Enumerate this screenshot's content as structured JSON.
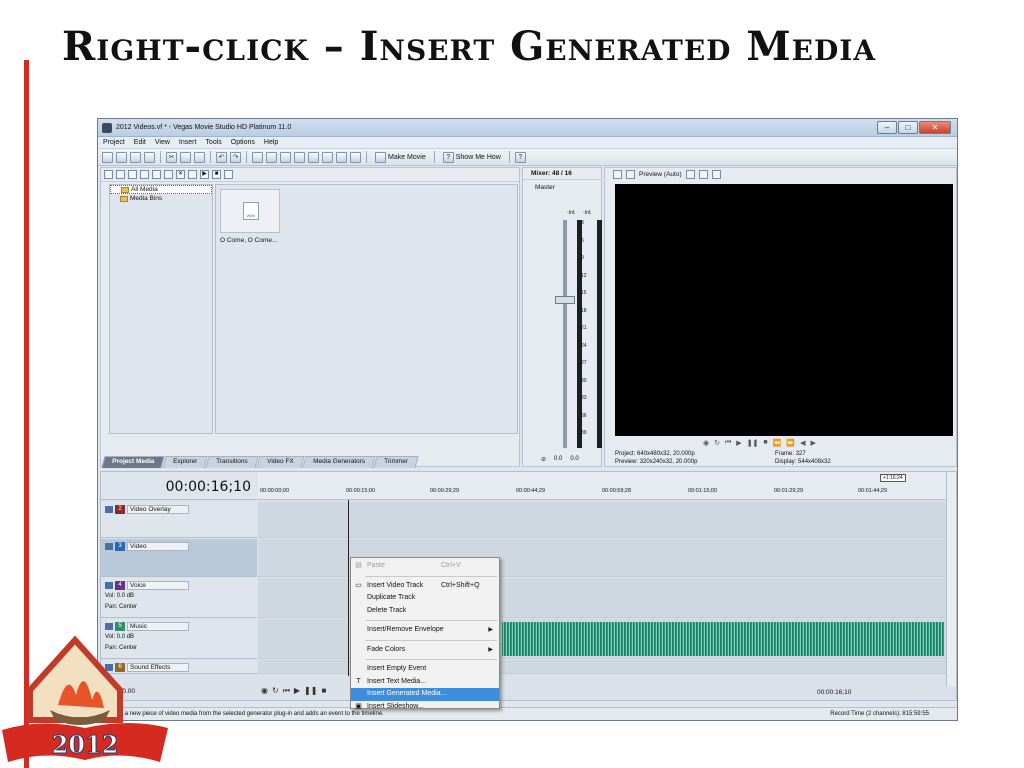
{
  "slide": {
    "title": "Right-click – Insert Generated Media"
  },
  "window": {
    "title": "2012 Videos.vf * - Vegas Movie Studio HD Platinum 11.0",
    "menu": [
      "Project",
      "Edit",
      "View",
      "Insert",
      "Tools",
      "Options",
      "Help"
    ],
    "toolbar": {
      "make_movie": "Make Movie",
      "show_me_how": "Show Me How"
    }
  },
  "media_pane": {
    "tree": [
      "All Media",
      "Media Bins"
    ],
    "file_name": "O Come, O Come...",
    "file_badge": "WAV",
    "tabs": [
      "Project Media",
      "Explorer",
      "Transitions",
      "Video FX",
      "Media Generators",
      "Trimmer"
    ]
  },
  "mixer": {
    "header": "Mixer: 48 / 16",
    "master": "Master",
    "levels_top": [
      "-Inf.",
      "-Inf."
    ],
    "scale": [
      "3",
      "6",
      "9",
      "12",
      "15",
      "18",
      "21",
      "24",
      "27",
      "30",
      "33",
      "36",
      "39"
    ],
    "foot_values": [
      "0.0",
      "0.0"
    ]
  },
  "preview": {
    "mode": "Preview (Auto)",
    "project_label": "Project:",
    "project_value": "640x480x32, 20.000p",
    "preview_label": "Preview:",
    "preview_value": "320x240x32, 20.000p",
    "frame_label": "Frame:",
    "frame_value": "327",
    "display_label": "Display:",
    "display_value": "544x408x32"
  },
  "timeline": {
    "timecode": "00:00:16;10",
    "ruler": [
      "00:00:00;00",
      "00:00:15;00",
      "00:00:29;29",
      "00:00:44;29",
      "00:00:59;28",
      "00:01:15;00",
      "00:01:29;29",
      "00:01:44;29"
    ],
    "marker": "+1:16:24",
    "tracks": [
      {
        "num": "2",
        "name": "Video Overlay",
        "color": "#8a2a2a"
      },
      {
        "num": "3",
        "name": "Video",
        "color": "#2a6ab0"
      },
      {
        "num": "4",
        "name": "Voice",
        "color": "#6a2f8f",
        "vol": "0.0 dB",
        "pan": "Center"
      },
      {
        "num": "5",
        "name": "Music",
        "color": "#2f8f6a",
        "vol": "0.0 dB",
        "pan": "Center"
      },
      {
        "num": "6",
        "name": "Sound Effects",
        "color": "#8f6a2f"
      }
    ],
    "vol_label": "Vol:",
    "pan_label": "Pan:",
    "rate": "Rate: 0.00",
    "time_right": "00:00:16;10"
  },
  "context_menu": {
    "items": [
      {
        "label": "Paste",
        "shortcut": "Ctrl+V",
        "disabled": true
      },
      {
        "label": "Insert Video Track",
        "shortcut": "Ctrl+Shift+Q"
      },
      {
        "label": "Duplicate Track"
      },
      {
        "label": "Delete Track"
      },
      {
        "label": "Insert/Remove Envelope",
        "submenu": true
      },
      {
        "label": "Fade Colors",
        "submenu": true
      },
      {
        "label": "Insert Empty Event"
      },
      {
        "label": "Insert Text Media..."
      },
      {
        "label": "Insert Generated Media...",
        "highlight": true
      },
      {
        "label": "Insert Slideshow..."
      }
    ]
  },
  "status": {
    "text": "Creates a new piece of video media from the selected generator plug-in and adds an event to the timeline.",
    "record_time": "Record Time (2 channels): 815:59:55"
  },
  "logo": {
    "year": "2012"
  },
  "colors": {
    "accent_red": "#d42a20",
    "menu_highlight": "#3e8ddd",
    "waveform": "#2b9a7d"
  }
}
